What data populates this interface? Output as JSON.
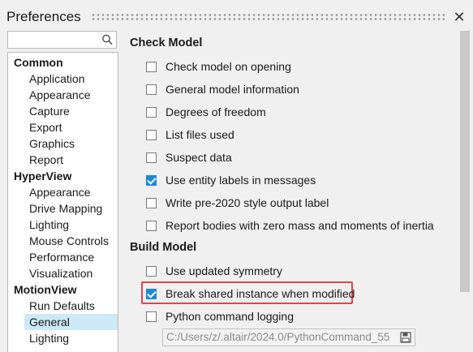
{
  "window": {
    "title": "Preferences",
    "close_glyph": "✕"
  },
  "search": {
    "value": "",
    "placeholder": ""
  },
  "tree": {
    "groups": [
      {
        "label": "Common",
        "items": [
          "Application",
          "Appearance",
          "Capture",
          "Export",
          "Graphics",
          "Report"
        ]
      },
      {
        "label": "HyperView",
        "items": [
          "Appearance",
          "Drive Mapping",
          "Lighting",
          "Mouse Controls",
          "Performance",
          "Visualization"
        ]
      },
      {
        "label": "MotionView",
        "items": [
          "Run Defaults",
          "General",
          "Lighting"
        ]
      }
    ],
    "selected": "MotionView/General"
  },
  "check_model": {
    "title": "Check Model",
    "options": [
      {
        "label": "Check model on opening",
        "checked": false
      },
      {
        "label": "General model information",
        "checked": false
      },
      {
        "label": "Degrees of freedom",
        "checked": false
      },
      {
        "label": "List files used",
        "checked": false
      },
      {
        "label": "Suspect data",
        "checked": false
      },
      {
        "label": "Use entity labels in messages",
        "checked": true
      },
      {
        "label": "Write pre-2020 style output label",
        "checked": false
      },
      {
        "label": "Report bodies with zero mass and moments of inertia",
        "checked": false
      }
    ]
  },
  "build_model": {
    "title": "Build Model",
    "options": [
      {
        "label": "Use updated symmetry",
        "checked": false
      },
      {
        "label": "Break shared instance when modified",
        "checked": true,
        "highlighted": true
      },
      {
        "label": "Python command logging",
        "checked": false
      }
    ],
    "log_path": "C:/Users/z/.altair/2024.0/PythonCommand_55"
  },
  "colors": {
    "accent": "#1e8ad6",
    "selection": "#cde8f7",
    "highlight_border": "#e0454a"
  },
  "icons": {
    "search": "search-icon",
    "close": "close-icon",
    "save": "save-icon"
  }
}
